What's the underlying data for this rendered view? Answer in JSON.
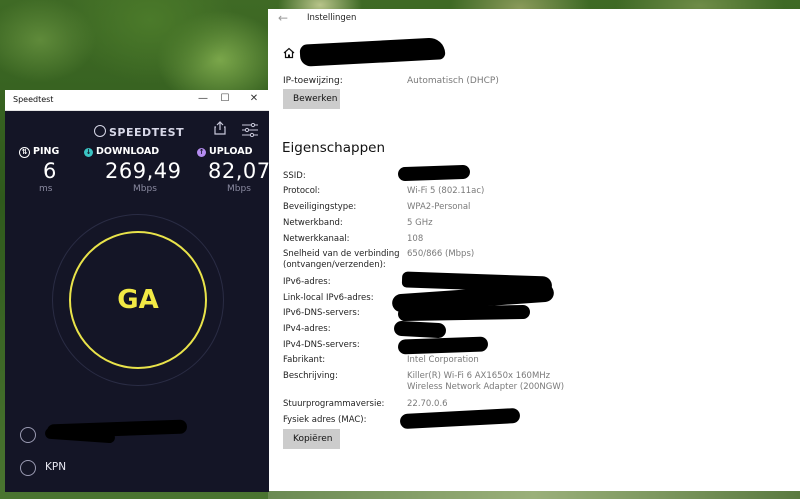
{
  "settings": {
    "title": "Instellingen",
    "ip_label": "IP-toewijzing:",
    "ip_value": "Automatisch (DHCP)",
    "edit_button": "Bewerken",
    "properties_heading": "Eigenschappen",
    "properties": [
      {
        "label": "SSID:",
        "value": ""
      },
      {
        "label": "Protocol:",
        "value": "Wi-Fi 5 (802.11ac)"
      },
      {
        "label": "Beveiligingstype:",
        "value": "WPA2-Personal"
      },
      {
        "label": "Netwerkband:",
        "value": "5 GHz"
      },
      {
        "label": "Netwerkkanaal:",
        "value": "108"
      },
      {
        "label": "Snelheid van de verbinding (ontvangen/verzenden):",
        "value": "650/866 (Mbps)"
      },
      {
        "label": "IPv6-adres:",
        "value": ""
      },
      {
        "label": "Link-local IPv6-adres:",
        "value": ""
      },
      {
        "label": "IPv6-DNS-servers:",
        "value": ""
      },
      {
        "label": "IPv4-adres:",
        "value": ""
      },
      {
        "label": "IPv4-DNS-servers:",
        "value": ""
      },
      {
        "label": "Fabrikant:",
        "value": "Intel Corporation"
      },
      {
        "label": "Beschrijving:",
        "value": "Killer(R) Wi-Fi 6 AX1650x 160MHz Wireless Network Adapter (200NGW)"
      },
      {
        "label": "Stuurprogrammaversie:",
        "value": "22.70.0.6"
      },
      {
        "label": "Fysiek adres (MAC):",
        "value": ""
      }
    ],
    "copy_button": "Kopiëren"
  },
  "speedtest": {
    "window_title": "Speedtest",
    "logo": "SPEEDTEST",
    "ping": {
      "label": "PING",
      "value": "6",
      "unit": "ms"
    },
    "download": {
      "label": "DOWNLOAD",
      "value": "269,49",
      "unit": "Mbps"
    },
    "upload": {
      "label": "UPLOAD",
      "value": "82,07",
      "unit": "Mbps"
    },
    "go_button": "GA",
    "provider": "KPN",
    "colors": {
      "go_ring": "#e9e34a",
      "download_icon": "#3bc4c4",
      "upload_icon": "#b58cf0",
      "background": "#141526"
    }
  }
}
